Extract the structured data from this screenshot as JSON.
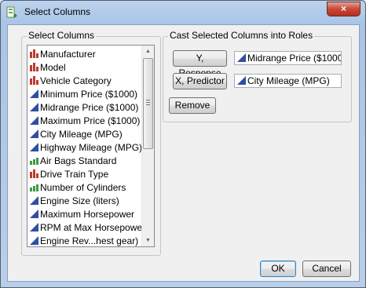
{
  "window": {
    "title": "Select Columns",
    "close_glyph": "×"
  },
  "select_columns": {
    "label": "Select Columns",
    "items": [
      {
        "label": "Manufacturer",
        "icon": "nominal-red-bars-icon"
      },
      {
        "label": "Model",
        "icon": "nominal-red-bars-icon"
      },
      {
        "label": "Vehicle Category",
        "icon": "nominal-red-bars-icon"
      },
      {
        "label": "Minimum Price ($1000)",
        "icon": "continuous-blue-triangle-icon"
      },
      {
        "label": "Midrange Price ($1000)",
        "icon": "continuous-blue-triangle-icon"
      },
      {
        "label": "Maximum Price ($1000)",
        "icon": "continuous-blue-triangle-icon"
      },
      {
        "label": "City Mileage (MPG)",
        "icon": "continuous-blue-triangle-icon"
      },
      {
        "label": "Highway Mileage (MPG)",
        "icon": "continuous-blue-triangle-icon"
      },
      {
        "label": "Air Bags Standard",
        "icon": "ordinal-green-bars-icon"
      },
      {
        "label": "Drive Train Type",
        "icon": "nominal-red-bars-icon"
      },
      {
        "label": "Number of Cylinders",
        "icon": "ordinal-green-bars-icon"
      },
      {
        "label": "Engine Size (liters)",
        "icon": "continuous-blue-triangle-icon"
      },
      {
        "label": "Maximum Horsepower",
        "icon": "continuous-blue-triangle-icon"
      },
      {
        "label": "RPM at Max Horsepower",
        "icon": "continuous-blue-triangle-icon"
      },
      {
        "label": "Engine Rev...hest gear)",
        "icon": "continuous-blue-triangle-icon"
      }
    ]
  },
  "cast_roles": {
    "label": "Cast Selected Columns into Roles",
    "y_button": "Y, Response",
    "y_value": "Midrange Price ($1000",
    "x_button": "X, Predictor",
    "x_value": "City Mileage (MPG)",
    "remove_button": "Remove"
  },
  "footer": {
    "ok": "OK",
    "cancel": "Cancel"
  },
  "colors": {
    "nominal": "#c0392b",
    "ordinal": "#3f9b3f",
    "continuous": "#2f4fa3"
  }
}
